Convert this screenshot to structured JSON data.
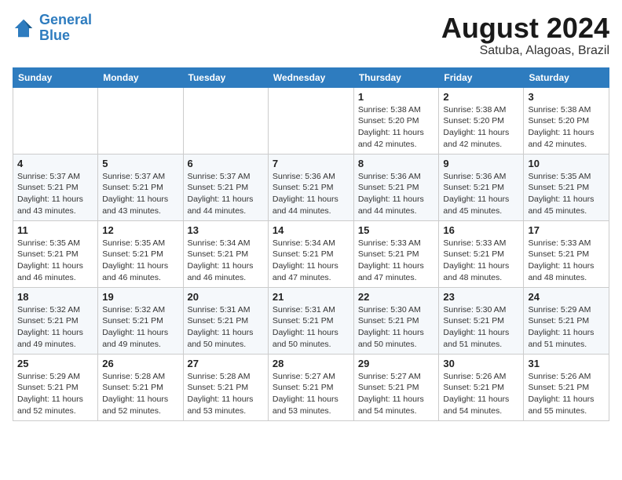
{
  "header": {
    "logo_line1": "General",
    "logo_line2": "Blue",
    "month_year": "August 2024",
    "location": "Satuba, Alagoas, Brazil"
  },
  "days_of_week": [
    "Sunday",
    "Monday",
    "Tuesday",
    "Wednesday",
    "Thursday",
    "Friday",
    "Saturday"
  ],
  "weeks": [
    [
      {
        "day": "",
        "info": ""
      },
      {
        "day": "",
        "info": ""
      },
      {
        "day": "",
        "info": ""
      },
      {
        "day": "",
        "info": ""
      },
      {
        "day": "1",
        "info": "Sunrise: 5:38 AM\nSunset: 5:20 PM\nDaylight: 11 hours and 42 minutes."
      },
      {
        "day": "2",
        "info": "Sunrise: 5:38 AM\nSunset: 5:20 PM\nDaylight: 11 hours and 42 minutes."
      },
      {
        "day": "3",
        "info": "Sunrise: 5:38 AM\nSunset: 5:20 PM\nDaylight: 11 hours and 42 minutes."
      }
    ],
    [
      {
        "day": "4",
        "info": "Sunrise: 5:37 AM\nSunset: 5:21 PM\nDaylight: 11 hours and 43 minutes."
      },
      {
        "day": "5",
        "info": "Sunrise: 5:37 AM\nSunset: 5:21 PM\nDaylight: 11 hours and 43 minutes."
      },
      {
        "day": "6",
        "info": "Sunrise: 5:37 AM\nSunset: 5:21 PM\nDaylight: 11 hours and 44 minutes."
      },
      {
        "day": "7",
        "info": "Sunrise: 5:36 AM\nSunset: 5:21 PM\nDaylight: 11 hours and 44 minutes."
      },
      {
        "day": "8",
        "info": "Sunrise: 5:36 AM\nSunset: 5:21 PM\nDaylight: 11 hours and 44 minutes."
      },
      {
        "day": "9",
        "info": "Sunrise: 5:36 AM\nSunset: 5:21 PM\nDaylight: 11 hours and 45 minutes."
      },
      {
        "day": "10",
        "info": "Sunrise: 5:35 AM\nSunset: 5:21 PM\nDaylight: 11 hours and 45 minutes."
      }
    ],
    [
      {
        "day": "11",
        "info": "Sunrise: 5:35 AM\nSunset: 5:21 PM\nDaylight: 11 hours and 46 minutes."
      },
      {
        "day": "12",
        "info": "Sunrise: 5:35 AM\nSunset: 5:21 PM\nDaylight: 11 hours and 46 minutes."
      },
      {
        "day": "13",
        "info": "Sunrise: 5:34 AM\nSunset: 5:21 PM\nDaylight: 11 hours and 46 minutes."
      },
      {
        "day": "14",
        "info": "Sunrise: 5:34 AM\nSunset: 5:21 PM\nDaylight: 11 hours and 47 minutes."
      },
      {
        "day": "15",
        "info": "Sunrise: 5:33 AM\nSunset: 5:21 PM\nDaylight: 11 hours and 47 minutes."
      },
      {
        "day": "16",
        "info": "Sunrise: 5:33 AM\nSunset: 5:21 PM\nDaylight: 11 hours and 48 minutes."
      },
      {
        "day": "17",
        "info": "Sunrise: 5:33 AM\nSunset: 5:21 PM\nDaylight: 11 hours and 48 minutes."
      }
    ],
    [
      {
        "day": "18",
        "info": "Sunrise: 5:32 AM\nSunset: 5:21 PM\nDaylight: 11 hours and 49 minutes."
      },
      {
        "day": "19",
        "info": "Sunrise: 5:32 AM\nSunset: 5:21 PM\nDaylight: 11 hours and 49 minutes."
      },
      {
        "day": "20",
        "info": "Sunrise: 5:31 AM\nSunset: 5:21 PM\nDaylight: 11 hours and 50 minutes."
      },
      {
        "day": "21",
        "info": "Sunrise: 5:31 AM\nSunset: 5:21 PM\nDaylight: 11 hours and 50 minutes."
      },
      {
        "day": "22",
        "info": "Sunrise: 5:30 AM\nSunset: 5:21 PM\nDaylight: 11 hours and 50 minutes."
      },
      {
        "day": "23",
        "info": "Sunrise: 5:30 AM\nSunset: 5:21 PM\nDaylight: 11 hours and 51 minutes."
      },
      {
        "day": "24",
        "info": "Sunrise: 5:29 AM\nSunset: 5:21 PM\nDaylight: 11 hours and 51 minutes."
      }
    ],
    [
      {
        "day": "25",
        "info": "Sunrise: 5:29 AM\nSunset: 5:21 PM\nDaylight: 11 hours and 52 minutes."
      },
      {
        "day": "26",
        "info": "Sunrise: 5:28 AM\nSunset: 5:21 PM\nDaylight: 11 hours and 52 minutes."
      },
      {
        "day": "27",
        "info": "Sunrise: 5:28 AM\nSunset: 5:21 PM\nDaylight: 11 hours and 53 minutes."
      },
      {
        "day": "28",
        "info": "Sunrise: 5:27 AM\nSunset: 5:21 PM\nDaylight: 11 hours and 53 minutes."
      },
      {
        "day": "29",
        "info": "Sunrise: 5:27 AM\nSunset: 5:21 PM\nDaylight: 11 hours and 54 minutes."
      },
      {
        "day": "30",
        "info": "Sunrise: 5:26 AM\nSunset: 5:21 PM\nDaylight: 11 hours and 54 minutes."
      },
      {
        "day": "31",
        "info": "Sunrise: 5:26 AM\nSunset: 5:21 PM\nDaylight: 11 hours and 55 minutes."
      }
    ]
  ]
}
